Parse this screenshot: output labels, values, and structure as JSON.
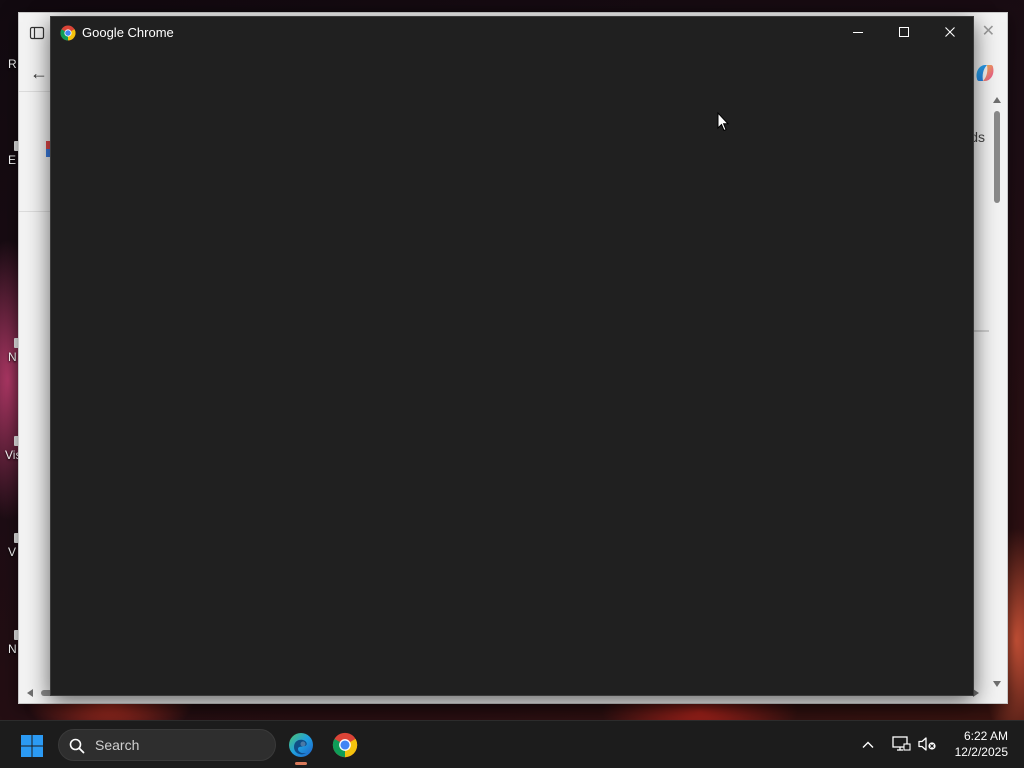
{
  "desktop": {
    "icon_labels": [
      "R",
      "E",
      "N",
      "Vis",
      "V",
      "N"
    ]
  },
  "background_window": {
    "right_text": "ds",
    "close_glyph": "✕",
    "back_glyph": "←"
  },
  "chrome_window": {
    "title": "Google Chrome",
    "minimize_icon": "minimize-icon",
    "maximize_icon": "maximize-icon",
    "close_icon": "close-icon",
    "content_background": "#202020"
  },
  "taskbar": {
    "search_placeholder": "Search",
    "apps": [
      {
        "name": "Microsoft Edge",
        "icon": "edge-icon"
      },
      {
        "name": "Google Chrome",
        "icon": "chrome-icon"
      }
    ],
    "clock": {
      "time": "6:22 AM",
      "date": "12/2/2025"
    }
  },
  "colors": {
    "chrome_dark": "#202020",
    "taskbar": "#1c1c1c",
    "windows_blue": "#2b9af3",
    "edge_blue": "#1f7fd4",
    "edge_green": "#4fc36a"
  }
}
